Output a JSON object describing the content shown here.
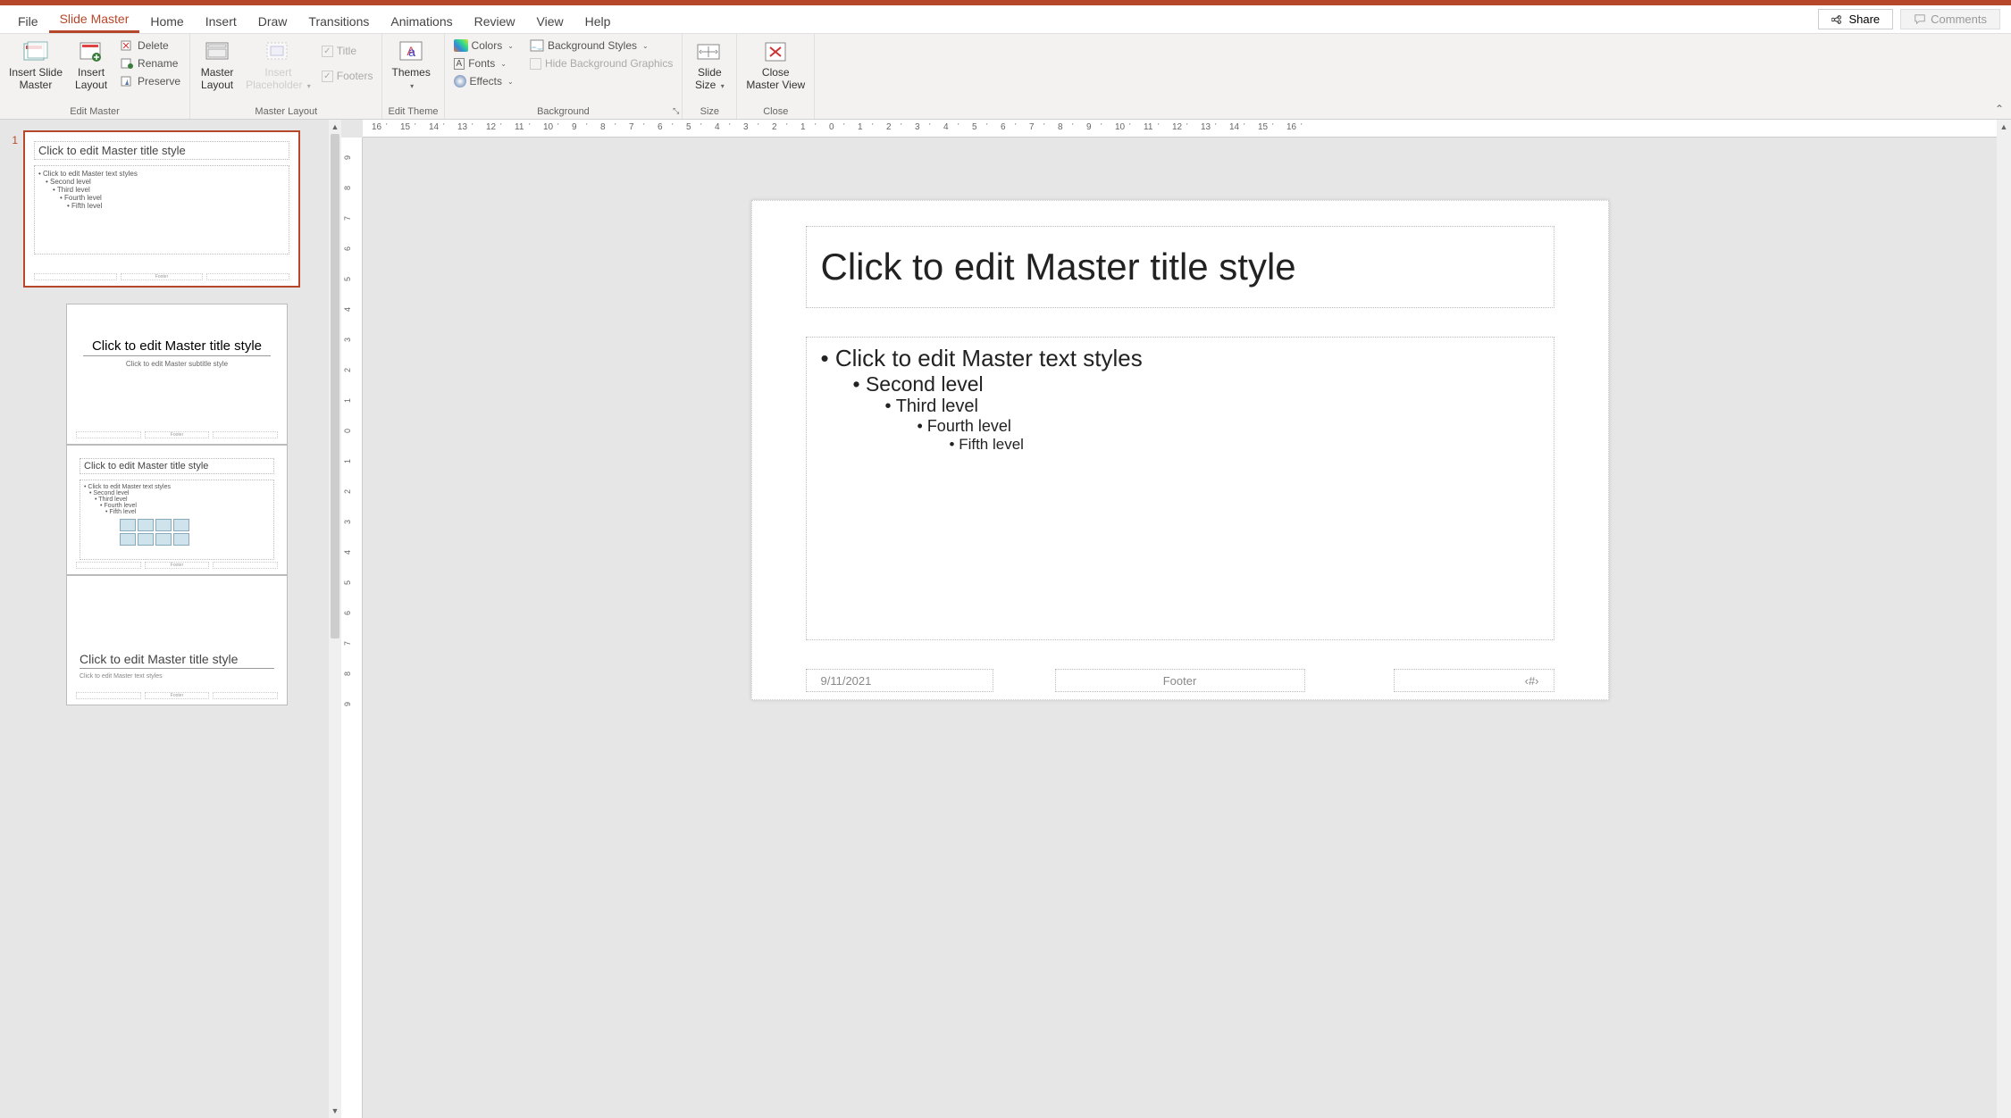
{
  "tabs": {
    "file": "File",
    "slide_master": "Slide Master",
    "home": "Home",
    "insert": "Insert",
    "draw": "Draw",
    "transitions": "Transitions",
    "animations": "Animations",
    "review": "Review",
    "view": "View",
    "help": "Help"
  },
  "actions": {
    "share": "Share",
    "comments": "Comments"
  },
  "ribbon": {
    "edit_master": {
      "insert_slide_master": "Insert Slide\nMaster",
      "insert_layout": "Insert\nLayout",
      "delete": "Delete",
      "rename": "Rename",
      "preserve": "Preserve",
      "group_label": "Edit Master"
    },
    "master_layout": {
      "master_layout": "Master\nLayout",
      "insert_placeholder": "Insert\nPlaceholder",
      "title": "Title",
      "footers": "Footers",
      "group_label": "Master Layout"
    },
    "edit_theme": {
      "themes": "Themes",
      "group_label": "Edit Theme"
    },
    "background": {
      "colors": "Colors",
      "fonts": "Fonts",
      "effects": "Effects",
      "bg_styles": "Background Styles",
      "hide_bg": "Hide Background Graphics",
      "group_label": "Background"
    },
    "size": {
      "slide_size": "Slide\nSize",
      "group_label": "Size"
    },
    "close": {
      "close_master": "Close\nMaster View",
      "group_label": "Close"
    }
  },
  "thumbnails": {
    "master_number": "1",
    "master_title": "Click to edit Master title style",
    "master_body_l1": "• Click to edit Master text styles",
    "master_body_l2": "• Second level",
    "master_body_l3": "• Third level",
    "master_body_l4": "• Fourth level",
    "master_body_l5": "• Fifth level",
    "layout1_title": "Click to edit Master title style",
    "layout1_subtitle": "Click to edit Master subtitle style",
    "layout2_title": "Click to edit Master title style",
    "layout2_body_l1": "• Click to edit Master text styles",
    "layout2_body_l2": "• Second level",
    "layout2_body_l3": "• Third level",
    "layout2_body_l4": "• Fourth level",
    "layout2_body_l5": "• Fifth level",
    "layout3_title": "Click to edit Master title style",
    "layout3_sub": "Click to edit Master text styles",
    "footer_label": "Footer"
  },
  "editor": {
    "title": "Click to edit Master title style",
    "body_l1": "Click to edit Master text styles",
    "body_l2": "Second level",
    "body_l3": "Third level",
    "body_l4": "Fourth level",
    "body_l5": "Fifth level",
    "date": "9/11/2021",
    "footer": "Footer",
    "slidenum": "‹#›"
  },
  "ruler": {
    "h": [
      "16",
      "15",
      "14",
      "13",
      "12",
      "11",
      "10",
      "9",
      "8",
      "7",
      "6",
      "5",
      "4",
      "3",
      "2",
      "1",
      "0",
      "1",
      "2",
      "3",
      "4",
      "5",
      "6",
      "7",
      "8",
      "9",
      "10",
      "11",
      "12",
      "13",
      "14",
      "15",
      "16"
    ],
    "v": [
      "9",
      "8",
      "7",
      "6",
      "5",
      "4",
      "3",
      "2",
      "1",
      "0",
      "1",
      "2",
      "3",
      "4",
      "5",
      "6",
      "7",
      "8",
      "9"
    ]
  }
}
